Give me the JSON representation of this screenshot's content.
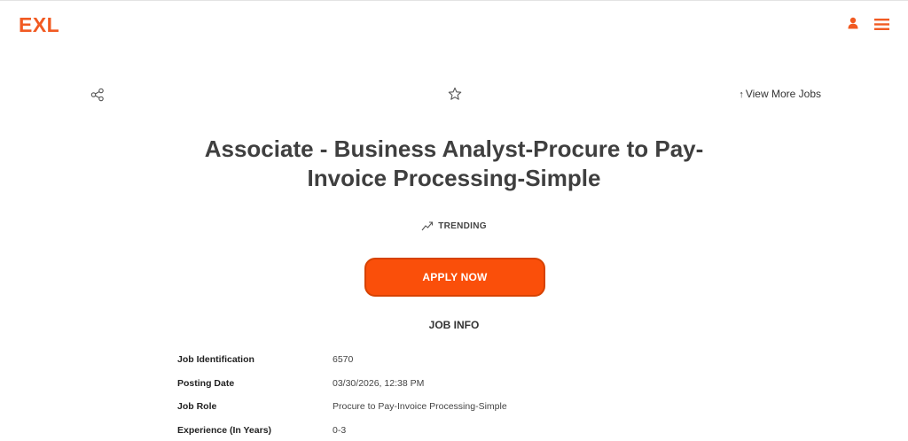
{
  "header": {
    "logo_text": "EXL",
    "icons": [
      "user-icon",
      "hamburger-menu-icon"
    ]
  },
  "actions": {
    "share_icon": "share-icon",
    "favorite_icon": "star-icon",
    "view_more_arrow": "↑",
    "view_more_label": "View More Jobs"
  },
  "job": {
    "title_line1": "Associate - Business Analyst-Procure to Pay-",
    "title_line2": "Invoice Processing-Simple",
    "trending_label": "TRENDING",
    "apply_label": "APPLY NOW"
  },
  "job_info": {
    "heading": "JOB INFO",
    "rows": [
      {
        "label": "Job Identification",
        "value": "6570"
      },
      {
        "label": "Posting Date",
        "value": "03/30/2026, 12:38 PM"
      },
      {
        "label": "Job Role",
        "value": "Procure to Pay-Invoice Processing-Simple"
      },
      {
        "label": "Experience (In Years)",
        "value": "0-3"
      }
    ]
  },
  "colors": {
    "brand": "#f15a22",
    "apply_button": "#fa4f0a",
    "apply_border": "#d64200",
    "text": "#333333"
  }
}
